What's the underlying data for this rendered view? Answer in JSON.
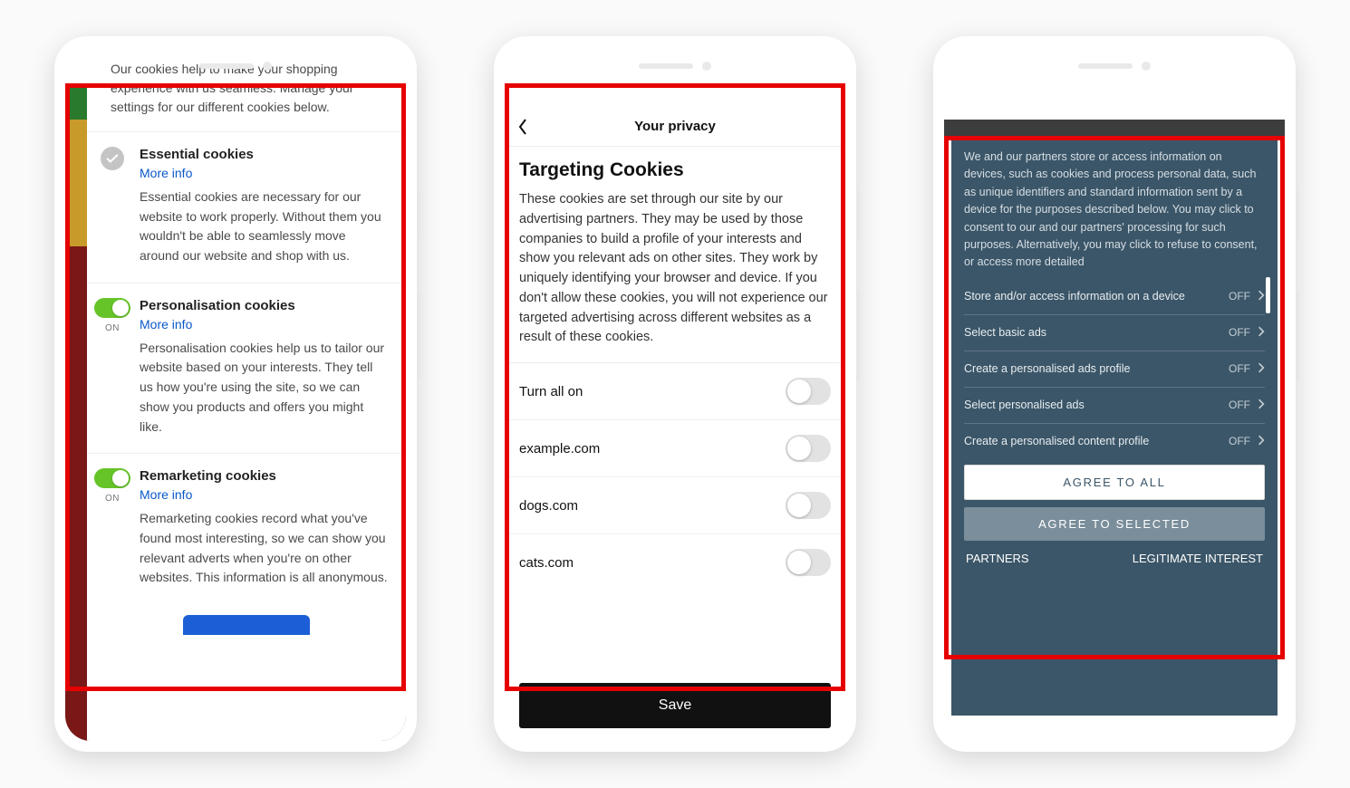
{
  "phone1": {
    "intro": "Our cookies help to make your shopping experience with us seamless. Manage your settings for our different cookies below.",
    "more_info_label": "More info",
    "on_label": "ON",
    "sections": [
      {
        "title": "Essential cookies",
        "desc": "Essential cookies are necessary for our website to work properly. Without them you wouldn't be able to seamlessly move around our website and shop with us."
      },
      {
        "title": "Personalisation cookies",
        "desc": "Personalisation cookies help us to tailor our website based on your interests. They tell us how you're using the site, so we can show you products and offers you might like."
      },
      {
        "title": "Remarketing cookies",
        "desc": "Remarketing cookies record what you've found most interesting, so we can show you relevant adverts when you're on other websites. This information is all anonymous."
      }
    ]
  },
  "phone2": {
    "header_title": "Your privacy",
    "heading": "Targeting Cookies",
    "paragraph": "These cookies are set through our site by our advertising partners. They may be used by those companies to build a profile of your interests and show you relevant ads on other sites. They work by uniquely identifying your browser and device. If you don't allow these cookies, you will not experience our targeted advertising across different websites as a result of these cookies.",
    "turn_all_label": "Turn all on",
    "domains": [
      "example.com",
      "dogs.com",
      "cats.com"
    ],
    "save_label": "Save"
  },
  "phone3": {
    "intro": "We and our partners store or access information on devices, such as cookies and process personal data, such as unique identifiers and standard information sent by a device for the purposes described below. You may click to consent to our and our partners' processing for such purposes. Alternatively, you may click to refuse to consent, or access more detailed",
    "off_label": "OFF",
    "items": [
      "Store and/or access information on a device",
      "Select basic ads",
      "Create a personalised ads profile",
      "Select personalised ads",
      "Create a personalised content profile"
    ],
    "agree_all": "AGREE TO ALL",
    "agree_selected": "AGREE TO SELECTED",
    "partners": "PARTNERS",
    "legit": "LEGITIMATE INTEREST"
  }
}
